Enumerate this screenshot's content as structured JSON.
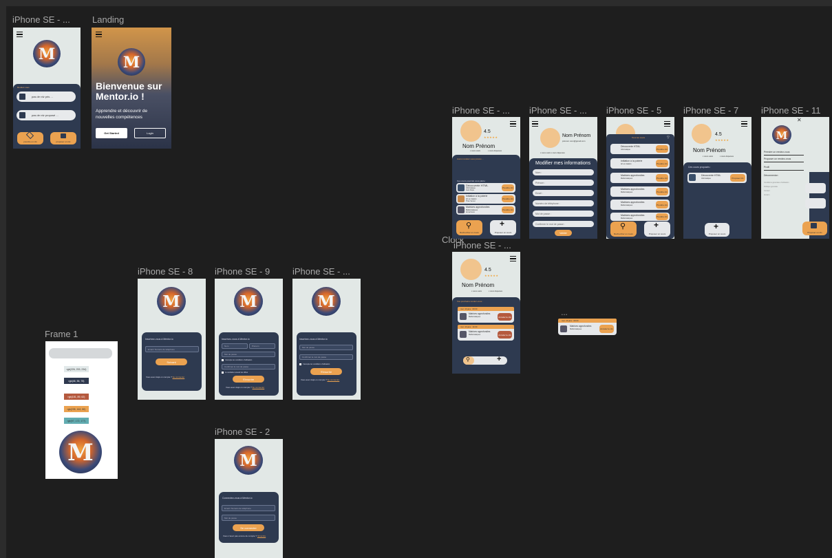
{
  "frames": {
    "iphone_se_1": "iPhone SE - ...",
    "landing": "Landing",
    "iphone_se_profile_a": "iPhone SE - ...",
    "iphone_se_profile_edit": "iPhone SE - ...",
    "iphone_se_5": "iPhone SE - 5",
    "iphone_se_7": "iPhone SE - 7",
    "iphone_se_11": "iPhone SE - 11",
    "clock": "Clock",
    "iphone_se_profile_b": "iPhone SE - ...",
    "iphone_se_8": "iPhone SE - 8",
    "iphone_se_9": "iPhone SE - 9",
    "iphone_se_signup3": "iPhone SE - ...",
    "frame_1": "Frame 1",
    "iphone_se_2": "iPhone SE - 2"
  },
  "home": {
    "section": "Rendez-vous",
    "items": [
      "pas de rdv pris ...",
      "pas de rdv proposé ..."
    ],
    "btn_take": "prendre un rdv",
    "btn_propose": "proposer un rdv"
  },
  "landing": {
    "title": "Bienvenue sur Mentor.io !",
    "subtitle": "Apprendre et découvrir de nouvelles compétences",
    "get_started": "Get Started",
    "login": "Login"
  },
  "profile": {
    "rating": "4.5",
    "stars": "★★★★★",
    "name": "Nom Prénom",
    "stats_a": "x cours suivis",
    "stats_b": "x cours dispensés",
    "empty_title": "Aucun rendez-vous prévus ...",
    "suggest_title": "Ces cours pourrais vous plaire :",
    "courses": [
      {
        "title": "Découverte HTML",
        "sub": "Informatique",
        "author": "Jean Dupe",
        "action": "Prendre rdv"
      },
      {
        "title": "Initiation à la poterie",
        "sub": "Art et création",
        "author": "Théo Vernet",
        "action": "Prendre rdv"
      },
      {
        "title": "Matrices approfondies",
        "sub": "Mathématiques",
        "author": "Anna Favre",
        "action": "Prendre rdv"
      }
    ],
    "search_btn": "Rechercher un cours",
    "propose_btn": "Proposer un cours",
    "plus": "+"
  },
  "edit": {
    "name": "Nom Prénom",
    "email": "prénom.nom@gmail.com",
    "stats": "x cours suivis  x cours dispensés",
    "title": "Modifier mes informations",
    "fields": [
      "Nom :",
      "Prénom :",
      "Email :",
      "Numéro de téléphone :",
      "Mot de passe :",
      "Confirmer le mot de passe :"
    ],
    "submit": "Valider"
  },
  "all_courses": {
    "header": "Tous les cours",
    "items": [
      {
        "title": "Découverte HTML",
        "sub": "Informatique",
        "action": "Prendre rdv"
      },
      {
        "title": "Initiation à la poterie",
        "sub": "Art et création",
        "action": "Prendre rdv"
      },
      {
        "title": "Matrices approfondies",
        "sub": "Mathématiques",
        "action": "Prendre rdv"
      },
      {
        "title": "Matrices approfondies",
        "sub": "Mathématiques",
        "action": "Prendre rdv"
      },
      {
        "title": "Matrices approfondies",
        "sub": "Mathématiques",
        "action": "Prendre rdv"
      },
      {
        "title": "Matrices approfondies",
        "sub": "Mathématiques",
        "action": "Prendre rdv"
      }
    ]
  },
  "proposed": {
    "title": "Ces cours proposés :",
    "course": "Découverte HTML",
    "sub": "Informatique",
    "action": "Proposer rdv",
    "btn": "Proposer un cours"
  },
  "menu": {
    "items": [
      "Prendre un rendez-vous",
      "Proposer un rendez-vous",
      "Profil",
      "Déconnexion"
    ],
    "minor": [
      "Conditions générales d'utilisation",
      "Politique générale",
      "Contact",
      "Version"
    ],
    "btn": "Proposer un rdv"
  },
  "upcoming": {
    "title": "Vos prochains rendez-vous :",
    "items": [
      {
        "date": "mer. 13 janv.",
        "time": "09:00",
        "title": "Matrices approfondies",
        "sub": "Mathématiques",
        "action": "Annuler le rdv"
      },
      {
        "date": "mer. 13 janv.",
        "time": "14:00",
        "title": "Matrices approfondies",
        "sub": "Mathématiques",
        "action": "Annuler le rdv"
      }
    ]
  },
  "floating": {
    "dots": "• • •",
    "date": "mer. 13 janv.",
    "time": "09:00",
    "title": "Matrices approfondies",
    "sub": "Mathématiques",
    "action": "Annuler le rdv"
  },
  "signup": {
    "title": "Inscrivez-vous à Mentor.io",
    "email_ph": "Email / Numéro de téléphone",
    "next": "Suivant",
    "have_account": "Vous avez déjà un compte ?",
    "login_link": "Se connecter",
    "name_ph": "Nom",
    "firstname_ph": "Prénom",
    "password_ph": "Mot de passe",
    "confirm_ph": "Confirmer le mot de passe",
    "cgu": "J'accepte les conditions d'utilisation",
    "news": "Je souhaite recevoir les offres",
    "submit": "S'inscrire"
  },
  "login": {
    "title": "Connectez-vous à Mentor.io",
    "email_ph": "Email / Numéro de téléphone",
    "password_ph": "Mot de passe",
    "btn": "Se connecter",
    "no_account": "Vous n'avez pas encore de compte ?",
    "signup_link": "S'inscrire"
  },
  "palette": {
    "labels": [
      "rgb(226, 233, 234)",
      "rgb(46, 56, 78)",
      "rgb(181, 89, 62)",
      "rgb(235, 162, 80)",
      "rgb(97, 172, 177)"
    ],
    "colors": [
      "#e2e9ea",
      "#2e384e",
      "#b5593e",
      "#eba250",
      "#61acb1"
    ]
  }
}
